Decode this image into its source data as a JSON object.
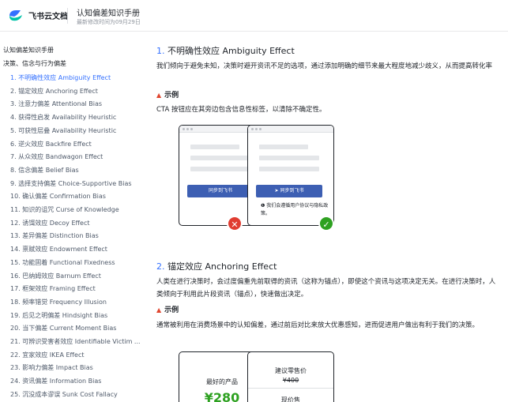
{
  "header": {
    "brand": "飞书云文档",
    "title": "认知偏差知识手册",
    "subtitle": "最新修改时间为09月29日"
  },
  "sidebar": {
    "root": "认知偏差知识手册",
    "section": "决策、信念与行为偏差",
    "items": [
      {
        "label": "1. 不明确性效应 Ambiguity Effect",
        "active": true
      },
      {
        "label": "2. 锚定效应 Anchoring Effect"
      },
      {
        "label": "3. 注意力偏差 Attentional Bias"
      },
      {
        "label": "4. 获得性启发 Availability Heuristic"
      },
      {
        "label": "5. 可获性层叠 Availability Heuristic"
      },
      {
        "label": "6. 逆火效应 Backfire Effect"
      },
      {
        "label": "7. 从众效应 Bandwagon Effect"
      },
      {
        "label": "8. 信念偏差 Belief Bias"
      },
      {
        "label": "9. 选择支持偏差 Choice-Supportive Bias"
      },
      {
        "label": "10. 确认偏差 Confirmation Bias"
      },
      {
        "label": "11. 知识的诅咒 Curse of Knowledge"
      },
      {
        "label": "12. 诱饵效应 Decoy Effect"
      },
      {
        "label": "13. 差异偏差 Distinction Bias"
      },
      {
        "label": "14. 禀赋效应 Endowment Effect"
      },
      {
        "label": "15. 功能固着 Functional Fixedness"
      },
      {
        "label": "16. 巴纳姆效应 Barnum Effect"
      },
      {
        "label": "17. 框架效应 Framing Effect"
      },
      {
        "label": "18. 频率错觉 Frequency Illusion"
      },
      {
        "label": "19. 后见之明偏差 Hindsight Bias"
      },
      {
        "label": "20. 当下偏差 Current Moment Bias"
      },
      {
        "label": "21. 可辨识受害者效应 Identifiable Victim ..."
      },
      {
        "label": "22. 宜家效应 IKEA Effect"
      },
      {
        "label": "23. 影响力偏差 Impact Bias"
      },
      {
        "label": "24. 资讯偏差 Information Bias"
      },
      {
        "label": "25. 沉没成本谬误 Sunk Cost Fallacy"
      }
    ]
  },
  "content": {
    "section1": {
      "num": "1.",
      "title": "不明确性效应 Ambiguity Effect",
      "body": "我们倾向于避免未知，决策时避开资讯不足的选项，通过添加明确的细节来最大程度地减少歧义，从而提高转化率",
      "example_label": "示例",
      "example_text": "CTA 按钮应在其旁边包含信息性标签，以清除不确定性。",
      "mock_left_button": "同步到飞书",
      "mock_right_button": "同步到飞书",
      "mock_note": "我们会遵循用户协议与隐私政策。",
      "bad_mark": "✕",
      "good_mark": "✓"
    },
    "section2": {
      "num": "2.",
      "title": "锚定效应 Anchoring Effect",
      "body": "人类在进行决策时，会过度偏重先前取得的资讯（这称为锚点），即使这个资讯与这项决定无关。在进行决策时，人类倾向于利用此片段资讯（锚点），快速做出决定。",
      "example_label": "示例",
      "example_text": "通常被利用在消费场景中的认知偏差，通过前后对比来放大优惠感知，进而促进用户做出有利于我们的决策。",
      "card_left_title": "最好的产品",
      "card_left_price": "¥280",
      "card_right_title": "建议零售价",
      "card_right_old": "¥400",
      "card_right_sub": "现价售"
    }
  },
  "colors": {
    "accent": "#3370ff",
    "cta": "#3d5fb3",
    "error": "#e03c31",
    "success": "#2ea121"
  }
}
